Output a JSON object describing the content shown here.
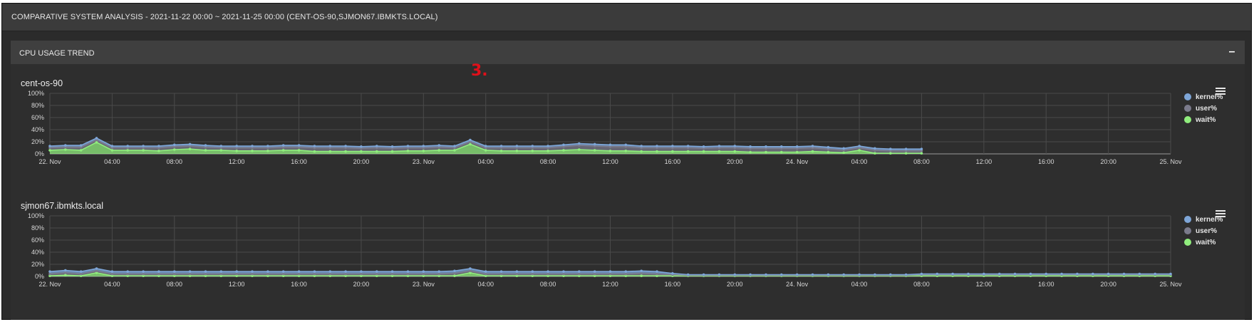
{
  "header": {
    "title": "COMPARATIVE SYSTEM ANALYSIS - 2021-11-22 00:00 ~ 2021-11-25 00:00 (CENT-OS-90,SJMON67.IBMKTS.LOCAL)"
  },
  "panel": {
    "title": "CPU USAGE TREND",
    "collapse_label": "–"
  },
  "annotation": {
    "marker": "3."
  },
  "colors": {
    "kernel": "#7ea6d8",
    "user": "#7b7b8c",
    "wait": "#90ed7d",
    "background": "#2b2b2b",
    "grid": "#4a4a4a"
  },
  "icons": {
    "menu": "hamburger-menu-icon"
  },
  "x_tick_labels": [
    "22. Nov",
    "04:00",
    "08:00",
    "12:00",
    "16:00",
    "20:00",
    "23. Nov",
    "04:00",
    "08:00",
    "12:00",
    "16:00",
    "20:00",
    "24. Nov",
    "04:00",
    "08:00",
    "12:00",
    "16:00",
    "20:00",
    "25. Nov"
  ],
  "y_tick_labels": [
    "0%",
    "20%",
    "40%",
    "60%",
    "80%",
    "100%"
  ],
  "chart_data": [
    {
      "type": "area",
      "title": "cent-os-90",
      "xlabel": "",
      "ylabel": "",
      "x_range": [
        "2021-11-22 00:00",
        "2021-11-25 00:00"
      ],
      "ylim": [
        0,
        100
      ],
      "grid": true,
      "legend_position": "right",
      "stacked": true,
      "x": [
        "2021-11-22 00:00",
        "2021-11-22 01:00",
        "2021-11-22 02:00",
        "2021-11-22 03:00",
        "2021-11-22 04:00",
        "2021-11-22 05:00",
        "2021-11-22 06:00",
        "2021-11-22 07:00",
        "2021-11-22 08:00",
        "2021-11-22 09:00",
        "2021-11-22 10:00",
        "2021-11-22 11:00",
        "2021-11-22 12:00",
        "2021-11-22 13:00",
        "2021-11-22 14:00",
        "2021-11-22 15:00",
        "2021-11-22 16:00",
        "2021-11-22 17:00",
        "2021-11-22 18:00",
        "2021-11-22 19:00",
        "2021-11-22 20:00",
        "2021-11-22 21:00",
        "2021-11-22 22:00",
        "2021-11-22 23:00",
        "2021-11-23 00:00",
        "2021-11-23 01:00",
        "2021-11-23 02:00",
        "2021-11-23 03:00",
        "2021-11-23 04:00",
        "2021-11-23 05:00",
        "2021-11-23 06:00",
        "2021-11-23 07:00",
        "2021-11-23 08:00",
        "2021-11-23 09:00",
        "2021-11-23 10:00",
        "2021-11-23 11:00",
        "2021-11-23 12:00",
        "2021-11-23 13:00",
        "2021-11-23 14:00",
        "2021-11-23 15:00",
        "2021-11-23 16:00",
        "2021-11-23 17:00",
        "2021-11-23 18:00",
        "2021-11-23 19:00",
        "2021-11-23 20:00",
        "2021-11-23 21:00",
        "2021-11-23 22:00",
        "2021-11-23 23:00",
        "2021-11-24 00:00",
        "2021-11-24 01:00",
        "2021-11-24 02:00",
        "2021-11-24 03:00",
        "2021-11-24 04:00",
        "2021-11-24 05:00",
        "2021-11-24 06:00",
        "2021-11-24 07:00",
        "2021-11-24 08:00"
      ],
      "series": [
        {
          "name": "kernel%",
          "values": [
            3,
            3,
            3,
            3,
            3,
            3,
            3,
            3,
            3,
            3,
            3,
            3,
            3,
            3,
            3,
            3,
            3,
            3,
            3,
            3,
            3,
            3,
            3,
            3,
            3,
            3,
            3,
            3,
            3,
            3,
            3,
            3,
            3,
            3,
            3,
            3,
            3,
            3,
            3,
            3,
            3,
            3,
            3,
            3,
            3,
            3,
            3,
            3,
            3,
            3,
            3,
            3,
            3,
            3,
            3,
            3,
            3
          ]
        },
        {
          "name": "user%",
          "values": [
            4,
            4,
            5,
            4,
            4,
            4,
            4,
            5,
            5,
            5,
            5,
            4,
            5,
            5,
            5,
            5,
            5,
            6,
            6,
            6,
            5,
            6,
            5,
            5,
            5,
            5,
            4,
            4,
            4,
            5,
            5,
            5,
            5,
            6,
            7,
            7,
            7,
            7,
            6,
            6,
            6,
            6,
            5,
            6,
            6,
            6,
            6,
            6,
            6,
            6,
            5,
            4,
            4,
            5,
            4,
            4,
            4
          ]
        },
        {
          "name": "wait%",
          "values": [
            6,
            7,
            6,
            19,
            6,
            6,
            6,
            5,
            7,
            8,
            6,
            6,
            5,
            5,
            5,
            6,
            6,
            4,
            4,
            4,
            4,
            4,
            4,
            5,
            5,
            6,
            6,
            16,
            6,
            5,
            5,
            5,
            5,
            6,
            7,
            6,
            5,
            5,
            4,
            4,
            4,
            4,
            4,
            4,
            4,
            3,
            3,
            3,
            3,
            4,
            3,
            2,
            6,
            1,
            1,
            1,
            1
          ]
        }
      ]
    },
    {
      "type": "area",
      "title": "sjmon67.ibmkts.local",
      "xlabel": "",
      "ylabel": "",
      "x_range": [
        "2021-11-22 00:00",
        "2021-11-25 00:00"
      ],
      "ylim": [
        0,
        100
      ],
      "grid": true,
      "legend_position": "right",
      "stacked": true,
      "x": [
        "2021-11-22 00:00",
        "2021-11-22 01:00",
        "2021-11-22 02:00",
        "2021-11-22 03:00",
        "2021-11-22 04:00",
        "2021-11-22 05:00",
        "2021-11-22 06:00",
        "2021-11-22 07:00",
        "2021-11-22 08:00",
        "2021-11-22 09:00",
        "2021-11-22 10:00",
        "2021-11-22 11:00",
        "2021-11-22 12:00",
        "2021-11-22 13:00",
        "2021-11-22 14:00",
        "2021-11-22 15:00",
        "2021-11-22 16:00",
        "2021-11-22 17:00",
        "2021-11-22 18:00",
        "2021-11-22 19:00",
        "2021-11-22 20:00",
        "2021-11-22 21:00",
        "2021-11-22 22:00",
        "2021-11-22 23:00",
        "2021-11-23 00:00",
        "2021-11-23 01:00",
        "2021-11-23 02:00",
        "2021-11-23 03:00",
        "2021-11-23 04:00",
        "2021-11-23 05:00",
        "2021-11-23 06:00",
        "2021-11-23 07:00",
        "2021-11-23 08:00",
        "2021-11-23 09:00",
        "2021-11-23 10:00",
        "2021-11-23 11:00",
        "2021-11-23 12:00",
        "2021-11-23 13:00",
        "2021-11-23 14:00",
        "2021-11-23 15:00",
        "2021-11-23 16:00",
        "2021-11-23 17:00",
        "2021-11-23 18:00",
        "2021-11-23 19:00",
        "2021-11-23 20:00",
        "2021-11-23 21:00",
        "2021-11-23 22:00",
        "2021-11-23 23:00",
        "2021-11-24 00:00",
        "2021-11-24 01:00",
        "2021-11-24 02:00",
        "2021-11-24 03:00",
        "2021-11-24 04:00",
        "2021-11-24 05:00",
        "2021-11-24 06:00",
        "2021-11-24 07:00",
        "2021-11-24 08:00",
        "2021-11-24 09:00",
        "2021-11-24 10:00",
        "2021-11-24 11:00",
        "2021-11-24 12:00",
        "2021-11-24 13:00",
        "2021-11-24 14:00",
        "2021-11-24 15:00",
        "2021-11-24 16:00",
        "2021-11-24 17:00",
        "2021-11-24 18:00",
        "2021-11-24 19:00",
        "2021-11-24 20:00",
        "2021-11-24 21:00",
        "2021-11-24 22:00",
        "2021-11-24 23:00",
        "2021-11-25 00:00"
      ],
      "series": [
        {
          "name": "kernel%",
          "values": [
            4,
            4,
            4,
            4,
            4,
            4,
            4,
            4,
            4,
            4,
            4,
            4,
            4,
            4,
            4,
            4,
            4,
            4,
            4,
            4,
            4,
            4,
            4,
            4,
            4,
            4,
            4,
            4,
            4,
            4,
            4,
            4,
            4,
            4,
            4,
            4,
            4,
            4,
            4,
            4,
            2,
            1,
            1,
            1,
            1,
            1,
            1,
            1,
            1,
            1,
            1,
            1,
            1,
            1,
            1,
            1,
            1,
            1,
            1,
            1,
            1,
            1,
            1,
            1,
            1,
            1,
            1,
            1,
            1,
            1,
            1,
            1,
            1
          ]
        },
        {
          "name": "user%",
          "values": [
            3,
            4,
            3,
            3,
            3,
            3,
            3,
            3,
            3,
            3,
            3,
            3,
            3,
            3,
            3,
            3,
            3,
            3,
            3,
            3,
            3,
            3,
            3,
            3,
            3,
            3,
            4,
            3,
            3,
            3,
            3,
            3,
            3,
            3,
            3,
            3,
            3,
            3,
            4,
            3,
            2,
            1,
            1,
            1,
            1,
            1,
            1,
            1,
            1,
            1,
            1,
            1,
            1,
            1,
            1,
            1,
            2,
            2,
            2,
            2,
            2,
            2,
            2,
            2,
            2,
            2,
            2,
            2,
            2,
            2,
            2,
            2,
            2
          ]
        },
        {
          "name": "wait%",
          "values": [
            1,
            2,
            1,
            6,
            1,
            1,
            1,
            1,
            1,
            1,
            1,
            1,
            1,
            1,
            1,
            1,
            1,
            1,
            1,
            1,
            1,
            1,
            1,
            1,
            1,
            1,
            1,
            6,
            1,
            1,
            1,
            1,
            1,
            1,
            1,
            1,
            1,
            1,
            1,
            1,
            1,
            1,
            1,
            1,
            1,
            1,
            1,
            1,
            1,
            1,
            1,
            1,
            1,
            1,
            1,
            1,
            1,
            1,
            1,
            1,
            1,
            1,
            1,
            1,
            1,
            1,
            1,
            1,
            1,
            1,
            1,
            1,
            1
          ]
        }
      ]
    }
  ]
}
